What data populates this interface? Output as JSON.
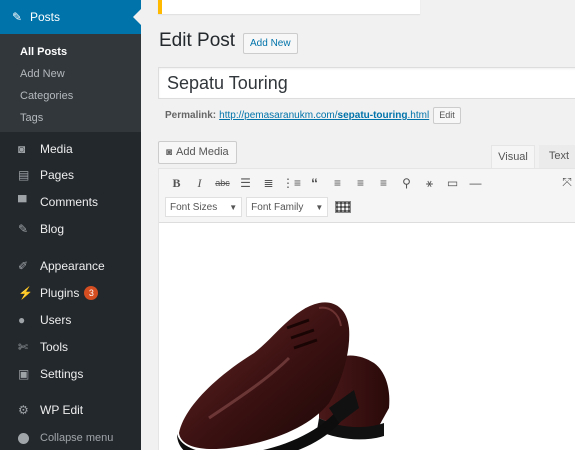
{
  "sidebar": {
    "posts": {
      "label": "Posts",
      "icon": "pin-icon"
    },
    "submenu": [
      {
        "label": "All Posts",
        "current": true
      },
      {
        "label": "Add New"
      },
      {
        "label": "Categories"
      },
      {
        "label": "Tags"
      }
    ],
    "items": [
      {
        "label": "Media",
        "icon": "media-icon"
      },
      {
        "label": "Pages",
        "icon": "pages-icon"
      },
      {
        "label": "Comments",
        "icon": "comments-icon"
      },
      {
        "label": "Blog",
        "icon": "pin-icon"
      },
      {
        "label": "Appearance",
        "icon": "appearance-icon"
      },
      {
        "label": "Plugins",
        "icon": "plugins-icon",
        "badge": "3"
      },
      {
        "label": "Users",
        "icon": "users-icon"
      },
      {
        "label": "Tools",
        "icon": "tools-icon"
      },
      {
        "label": "Settings",
        "icon": "settings-icon"
      },
      {
        "label": "WP Edit",
        "icon": "gear-icon"
      }
    ],
    "collapse_label": "Collapse menu"
  },
  "main": {
    "page_title": "Edit Post",
    "add_new_label": "Add New",
    "post_title": "Sepatu Touring",
    "permalink": {
      "label": "Permalink:",
      "url_base": "http://pemasaranukm.com/",
      "url_slug": "sepatu-touring",
      "url_ext": ".html",
      "edit_label": "Edit"
    },
    "add_media_label": "Add Media",
    "tabs": {
      "visual": "Visual",
      "text": "Text"
    },
    "toolbar": {
      "font_sizes": "Font Sizes",
      "font_family": "Font Family"
    }
  },
  "colors": {
    "sidebar_bg": "#23282d",
    "active_menu": "#0073aa",
    "badge": "#d54e21",
    "notice_border": "#ffba00"
  }
}
